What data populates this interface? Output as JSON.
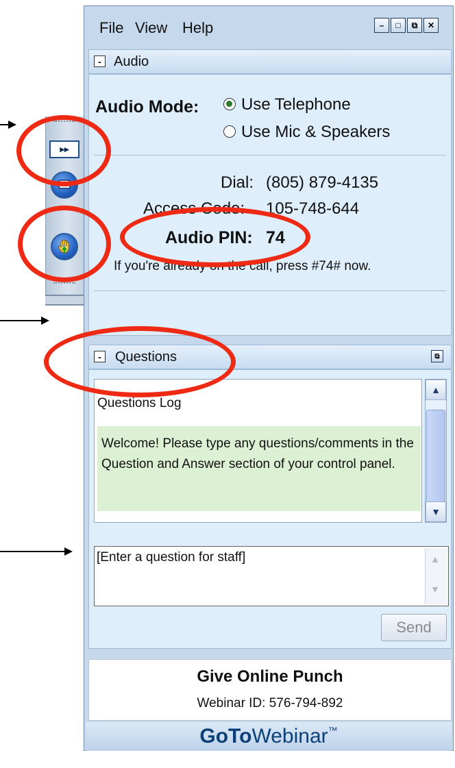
{
  "menu": {
    "file": "File",
    "view": "View",
    "help": "Help"
  },
  "window_buttons": {
    "minimize": "–",
    "restore": "□",
    "popout": "⧉",
    "close": "✕"
  },
  "toolbar": {
    "forward_glyph": "▸▸"
  },
  "audio": {
    "panel_title": "Audio",
    "mode_label": "Audio Mode:",
    "option_telephone": "Use Telephone",
    "option_mic": "Use Mic & Speakers",
    "selected": "Use Telephone",
    "dial_label": "Dial:",
    "dial_value": "(805) 879-4135",
    "access_label": "Access Code:",
    "access_value": "105-748-644",
    "pin_label": "Audio PIN:",
    "pin_value": "74",
    "instruction": "If you're already on the call, press #74# now."
  },
  "questions": {
    "panel_title": "Questions",
    "log_title": "Questions Log",
    "welcome": "Welcome! Please type any questions/comments in the Question and Answer section of your control panel.",
    "input_placeholder": "[Enter a question for staff]",
    "send_label": "Send"
  },
  "webinar": {
    "title": "Give Online Punch",
    "id_text": "Webinar ID: 576-794-892"
  },
  "brand": {
    "goto": "GoTo",
    "webinar": "Webinar",
    "tm": "™"
  },
  "colors": {
    "annotation": "#ee2a15",
    "brand_blue": "#0d3f78",
    "welcome_bg": "#dcf0d4"
  }
}
